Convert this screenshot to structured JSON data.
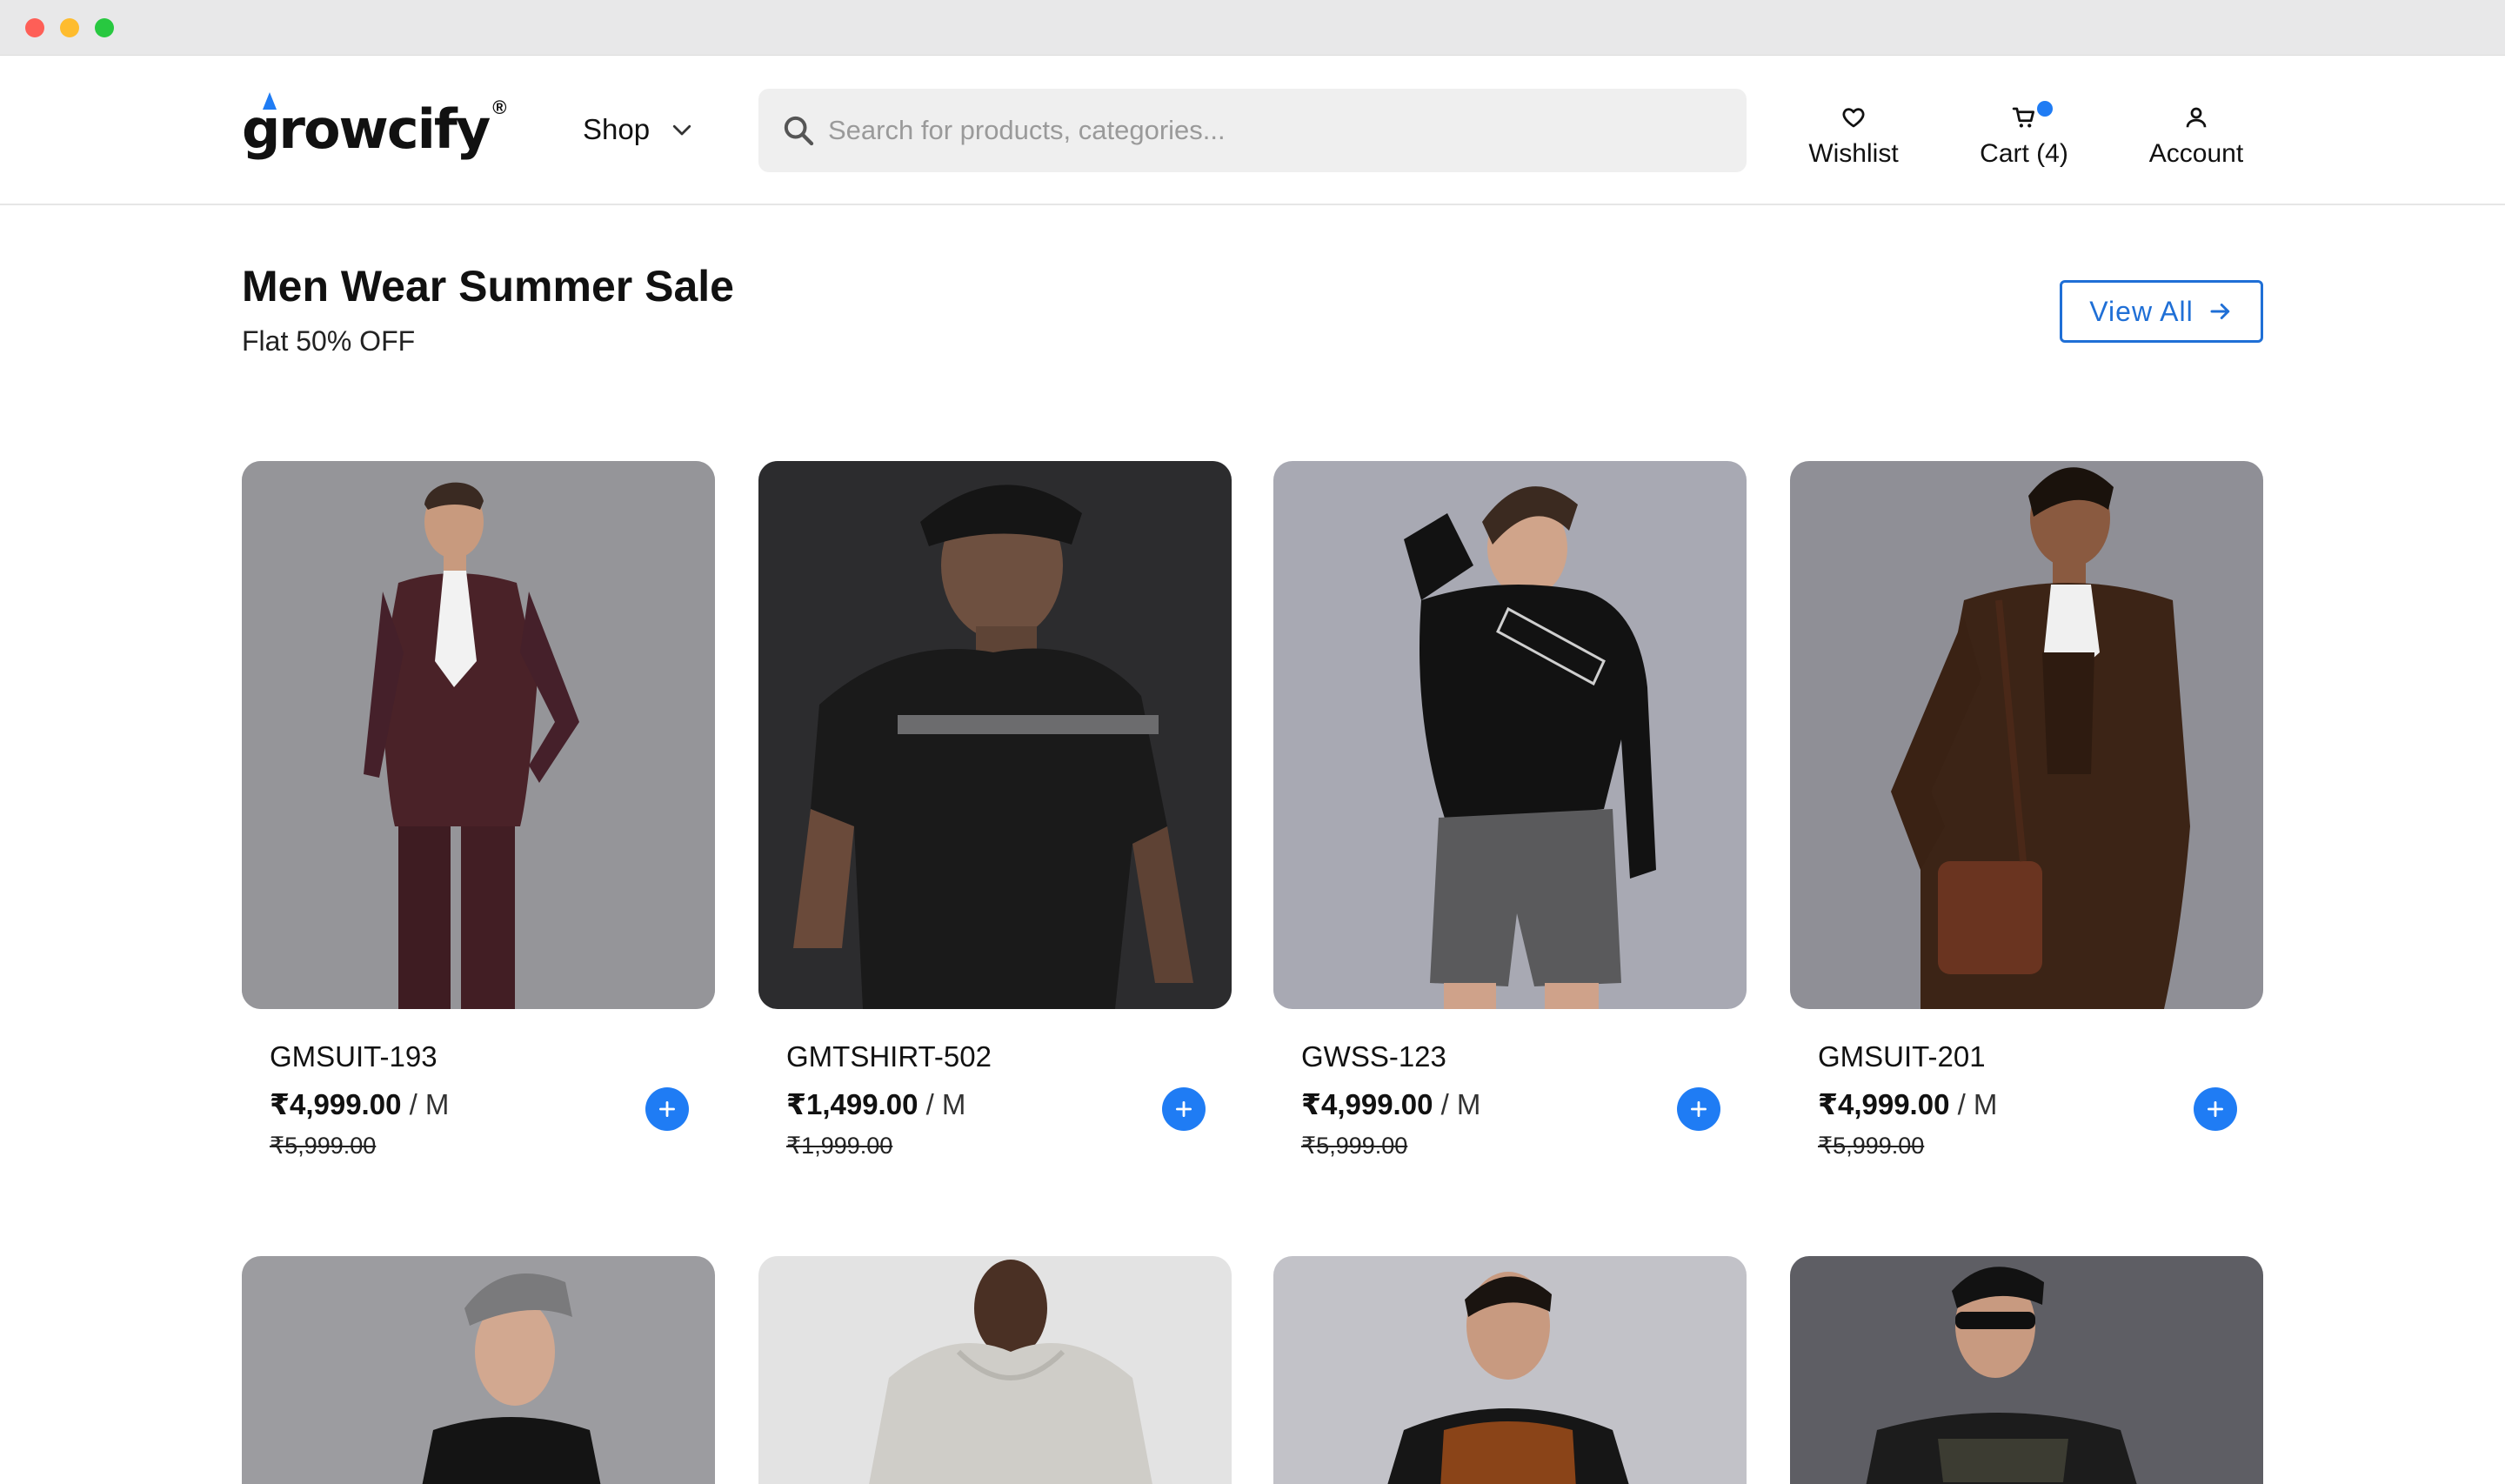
{
  "brand": {
    "name_first": "g",
    "name_rest": "rowcify",
    "registered_mark": "®",
    "accent_color": "#1f7cf4"
  },
  "nav": {
    "shop_label": "Shop"
  },
  "search": {
    "placeholder": "Search for products, categories..."
  },
  "header_actions": {
    "wishlist_label": "Wishlist",
    "cart_label": "Cart (4)",
    "account_label": "Account"
  },
  "section": {
    "title": "Men Wear Summer Sale",
    "subtitle": "Flat 50% OFF",
    "view_all_label": "View All"
  },
  "products": [
    {
      "name": "GMSUIT-193",
      "price": "₹4,999.00",
      "unit": " / M",
      "old_price": "₹5,999.00",
      "image": "man in burgundy suit"
    },
    {
      "name": "GMTSHIRT-502",
      "price": "₹1,499.00",
      "unit": " / M",
      "old_price": "₹1,999.00",
      "image": "man in black t-shirt and cap"
    },
    {
      "name": "GWSS-123",
      "price": "₹4,999.00",
      "unit": " / M",
      "old_price": "₹5,999.00",
      "image": "man in black sweatshirt and grey shorts"
    },
    {
      "name": "GMSUIT-201",
      "price": "₹4,999.00",
      "unit": " / M",
      "old_price": "₹5,999.00",
      "image": "man in brown three-piece suit with bag"
    }
  ],
  "products_row2": [
    {
      "image": "man in grey cap and black t-shirt"
    },
    {
      "image": "man in light grey hoodie"
    },
    {
      "image": "man in black and orange hoodie"
    },
    {
      "image": "man in sunglasses and black graphic t-shirt"
    }
  ]
}
